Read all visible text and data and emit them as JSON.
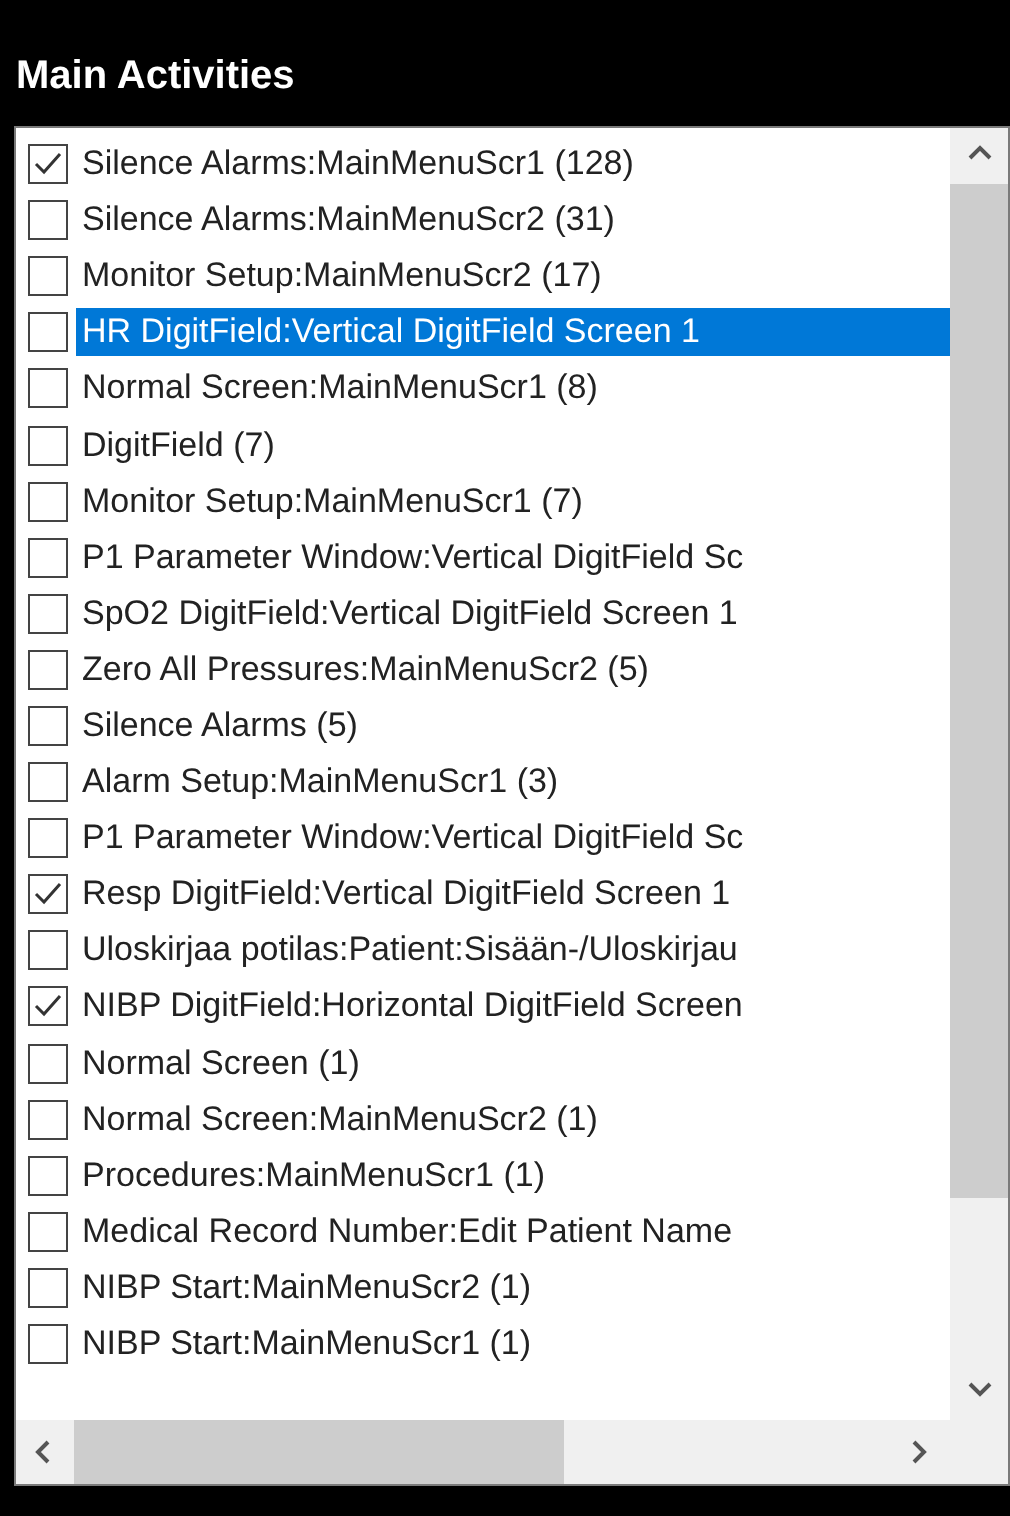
{
  "panel": {
    "title": "Main Activities"
  },
  "items": [
    {
      "label": "Silence Alarms:MainMenuScr1 (128)",
      "checked": true,
      "selected": false
    },
    {
      "label": "Silence Alarms:MainMenuScr2 (31)",
      "checked": false,
      "selected": false
    },
    {
      "label": "Monitor Setup:MainMenuScr2 (17)",
      "checked": false,
      "selected": false
    },
    {
      "label": "HR DigitField:Vertical DigitField Screen 1",
      "checked": false,
      "selected": true
    },
    {
      "label": "Normal Screen:MainMenuScr1 (8)",
      "checked": false,
      "selected": false
    },
    {
      "label": "DigitField (7)",
      "checked": false,
      "selected": false
    },
    {
      "label": "Monitor Setup:MainMenuScr1 (7)",
      "checked": false,
      "selected": false
    },
    {
      "label": "P1 Parameter Window:Vertical DigitField Sc",
      "checked": false,
      "selected": false
    },
    {
      "label": "SpO2 DigitField:Vertical DigitField Screen 1",
      "checked": false,
      "selected": false
    },
    {
      "label": "Zero All Pressures:MainMenuScr2 (5)",
      "checked": false,
      "selected": false
    },
    {
      "label": "Silence Alarms (5)",
      "checked": false,
      "selected": false
    },
    {
      "label": "Alarm Setup:MainMenuScr1 (3)",
      "checked": false,
      "selected": false
    },
    {
      "label": "P1 Parameter Window:Vertical DigitField Sc",
      "checked": false,
      "selected": false
    },
    {
      "label": "Resp DigitField:Vertical DigitField Screen 1",
      "checked": true,
      "selected": false
    },
    {
      "label": "Uloskirjaa potilas:Patient:Sisään-/Uloskirjau",
      "checked": false,
      "selected": false
    },
    {
      "label": "NIBP DigitField:Horizontal DigitField Screen",
      "checked": true,
      "selected": false
    },
    {
      "label": "Normal Screen (1)",
      "checked": false,
      "selected": false
    },
    {
      "label": "Normal Screen:MainMenuScr2 (1)",
      "checked": false,
      "selected": false
    },
    {
      "label": "Procedures:MainMenuScr1 (1)",
      "checked": false,
      "selected": false
    },
    {
      "label": "Medical Record Number:Edit Patient Name",
      "checked": false,
      "selected": false
    },
    {
      "label": "NIBP Start:MainMenuScr2 (1)",
      "checked": false,
      "selected": false
    },
    {
      "label": "NIBP Start:MainMenuScr1 (1)",
      "checked": false,
      "selected": false
    }
  ]
}
